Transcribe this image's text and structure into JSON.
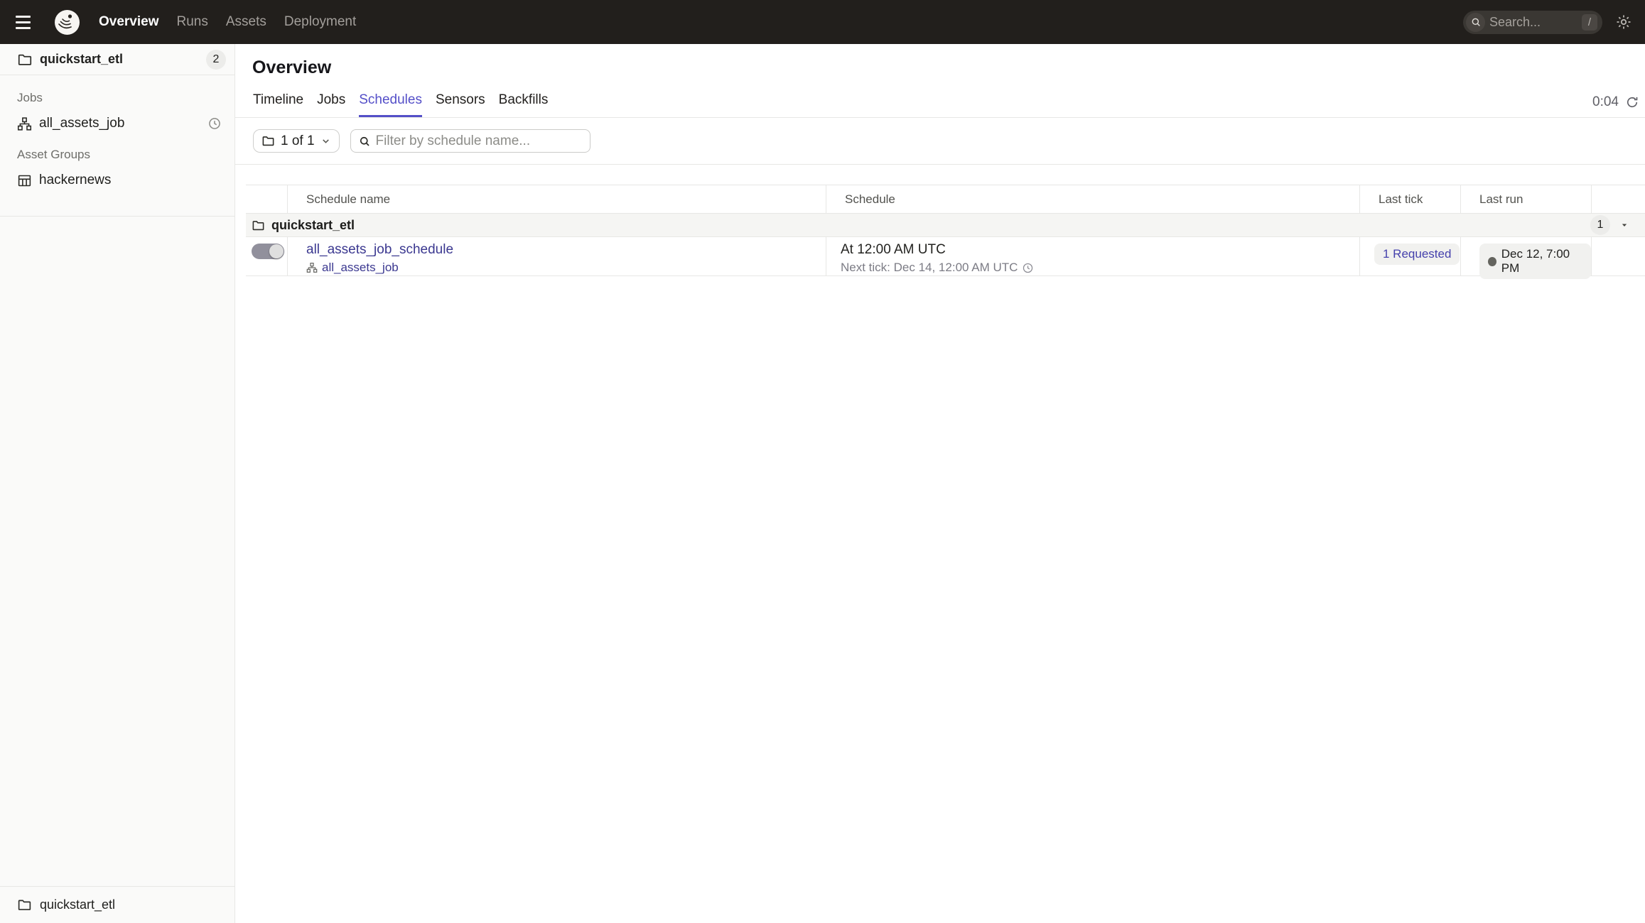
{
  "nav": {
    "items": [
      "Overview",
      "Runs",
      "Assets",
      "Deployment"
    ],
    "search_placeholder": "Search...",
    "search_shortcut": "/"
  },
  "sidebar": {
    "repo_name": "quickstart_etl",
    "repo_count": "2",
    "jobs_label": "Jobs",
    "job_item": "all_assets_job",
    "asset_groups_label": "Asset Groups",
    "asset_group_item": "hackernews",
    "footer_repo": "quickstart_etl"
  },
  "page": {
    "title": "Overview",
    "tabs": [
      {
        "label": "Timeline",
        "active": false
      },
      {
        "label": "Jobs",
        "active": false
      },
      {
        "label": "Schedules",
        "active": true
      },
      {
        "label": "Sensors",
        "active": false
      },
      {
        "label": "Backfills",
        "active": false
      }
    ],
    "refresh_timer": "0:04"
  },
  "filters": {
    "repo_filter": "1 of 1",
    "search_placeholder": "Filter by schedule name..."
  },
  "table": {
    "columns": [
      "Schedule name",
      "Schedule",
      "Last tick",
      "Last run"
    ],
    "group": {
      "name": "quickstart_etl",
      "count": "1"
    },
    "rows": [
      {
        "name": "all_assets_job_schedule",
        "target": "all_assets_job",
        "schedule": "At 12:00 AM UTC",
        "next_tick": "Next tick: Dec 14, 12:00 AM UTC",
        "last_tick": "1 Requested",
        "last_run": "Dec 12, 7:00 PM",
        "enabled": true
      }
    ]
  },
  "colors": {
    "accent": "#544FC8",
    "link": "#3B3890",
    "nav_bg": "#221F1C",
    "sidebar_bg": "#FAFAF9",
    "border": "#E7E7E5",
    "badge_bg": "#F1F1EF",
    "group_bg": "#F5F5F3",
    "dot": "#64645E"
  }
}
